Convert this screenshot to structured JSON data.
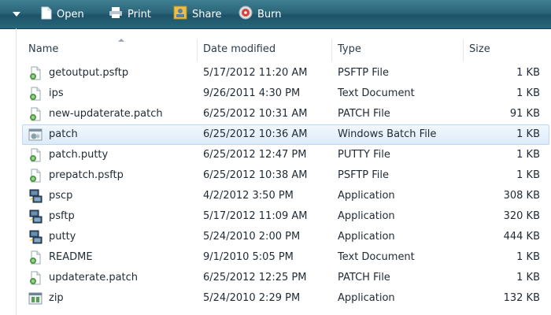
{
  "toolbar": {
    "items": [
      {
        "label": "Open",
        "icon": "document-icon"
      },
      {
        "label": "Print",
        "icon": "printer-icon"
      },
      {
        "label": "Share",
        "icon": "share-icon"
      },
      {
        "label": "Burn",
        "icon": "burn-disc-icon"
      }
    ]
  },
  "columns": {
    "name": "Name",
    "date": "Date modified",
    "type": "Type",
    "size": "Size"
  },
  "files": [
    {
      "name": "getoutput.psftp",
      "date": "5/17/2012 11:20 AM",
      "type": "PSFTP File",
      "size": "1 KB",
      "icon": "generic-file-icon"
    },
    {
      "name": "ips",
      "date": "9/26/2011 4:30 PM",
      "type": "Text Document",
      "size": "1 KB",
      "icon": "generic-file-icon"
    },
    {
      "name": "new-updaterate.patch",
      "date": "6/25/2012 10:31 AM",
      "type": "PATCH File",
      "size": "91 KB",
      "icon": "generic-file-icon"
    },
    {
      "name": "patch",
      "date": "6/25/2012 10:36 AM",
      "type": "Windows Batch File",
      "size": "1 KB",
      "icon": "batch-file-icon",
      "selected": true
    },
    {
      "name": "patch.putty",
      "date": "6/25/2012 12:47 PM",
      "type": "PUTTY File",
      "size": "1 KB",
      "icon": "generic-file-icon"
    },
    {
      "name": "prepatch.psftp",
      "date": "6/25/2012 10:38 AM",
      "type": "PSFTP File",
      "size": "1 KB",
      "icon": "generic-file-icon"
    },
    {
      "name": "pscp",
      "date": "4/2/2012 3:50 PM",
      "type": "Application",
      "size": "308 KB",
      "icon": "putty-app-icon"
    },
    {
      "name": "psftp",
      "date": "5/17/2012 11:09 AM",
      "type": "Application",
      "size": "320 KB",
      "icon": "putty-app-icon"
    },
    {
      "name": "putty",
      "date": "5/24/2010 2:00 PM",
      "type": "Application",
      "size": "444 KB",
      "icon": "putty-app-icon"
    },
    {
      "name": "README",
      "date": "9/1/2010 5:05 PM",
      "type": "Text Document",
      "size": "1 KB",
      "icon": "generic-file-icon"
    },
    {
      "name": "updaterate.patch",
      "date": "6/25/2012 12:25 PM",
      "type": "PATCH File",
      "size": "1 KB",
      "icon": "generic-file-icon"
    },
    {
      "name": "zip",
      "date": "5/24/2010 2:29 PM",
      "type": "Application",
      "size": "132 KB",
      "icon": "zip-app-icon"
    }
  ],
  "colors": {
    "toolbar": "#2b6478",
    "selection": "#dcebfa",
    "header_text": "#2b3c4d"
  }
}
